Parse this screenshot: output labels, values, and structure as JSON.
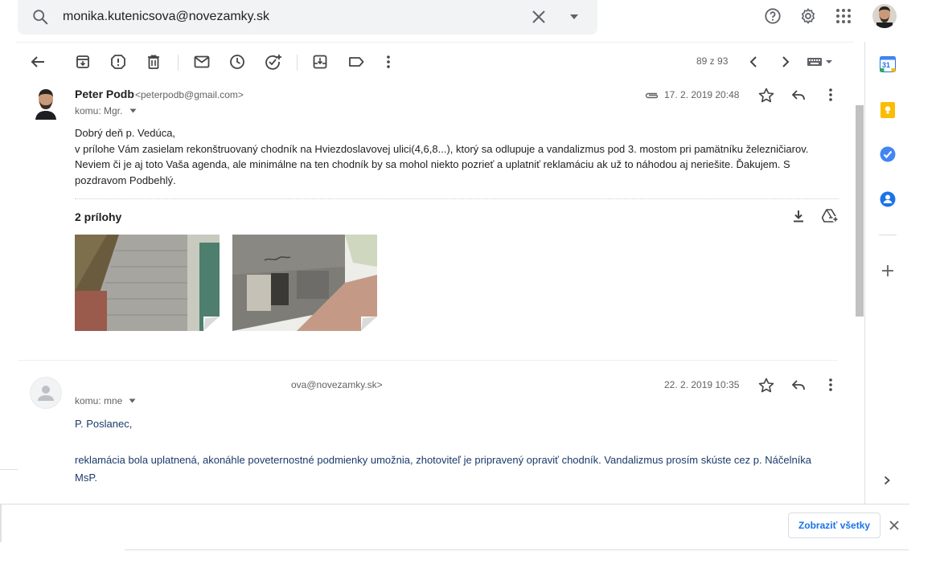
{
  "search": {
    "query": "monika.kutenicsova@novezamky.sk"
  },
  "toolbar": {
    "page_count": "89 z 93"
  },
  "message1": {
    "sender_name": "Peter Podb",
    "sender_email": "<peterpodb@gmail.com>",
    "recipient": "komu: Mgr.",
    "date": "17. 2. 2019 20:48",
    "body_lines": [
      "Dobrý deň p. Vedúca,",
      "v prílohe Vám zasielam rekonštruovaný chodník na Hviezdoslavovej ulici(4,6,8...), ktorý sa odlupuje a vandalizmus pod 3. mostom pri pamätníku železničiarov.",
      "Neviem či je aj toto Vaša agenda, ale minimálne na ten chodník by sa mohol niekto pozrieť a uplatniť reklamáciu ak už to náhodou aj neriešite. Ďakujem. S",
      "pozdravom Podbehlý."
    ],
    "attachments_title": "2 prílohy"
  },
  "message2": {
    "sender_email": "ova@novezamky.sk>",
    "recipient": "komu: mne",
    "date": "22. 2. 2019 10:35",
    "greeting": "P. Poslanec,",
    "body_line1": "reklamácia bola uplatnená, akonáhle poveternostné podmienky umožnia, zhotoviteľ je pripravený opraviť chodník. Vandalizmus prosím skúste cez p. Náčelníka",
    "body_line2": "MsP."
  },
  "bottombar": {
    "show_all_label": "Zobraziť všetky"
  },
  "side_panel": {
    "calendar_day": "31"
  },
  "colors": {
    "accent": "#1a73e8",
    "body2_text": "#1a3a6b",
    "keep_yellow": "#fbbc04",
    "tasks_blue": "#4285f4"
  },
  "icons": [
    "search-icon",
    "clear-icon",
    "dropdown-icon",
    "help-icon",
    "settings-icon",
    "apps-icon",
    "back-icon",
    "archive-icon",
    "spam-icon",
    "delete-icon",
    "mark-unread-icon",
    "snooze-icon",
    "add-task-icon",
    "move-to-icon",
    "label-icon",
    "more-icon",
    "prev-icon",
    "next-icon",
    "keyboard-icon",
    "paperclip-icon",
    "star-icon",
    "reply-icon",
    "download-icon",
    "drive-icon",
    "calendar-icon",
    "keep-icon",
    "tasks-icon",
    "contacts-icon",
    "add-icon",
    "expand-icon",
    "close-icon"
  ]
}
